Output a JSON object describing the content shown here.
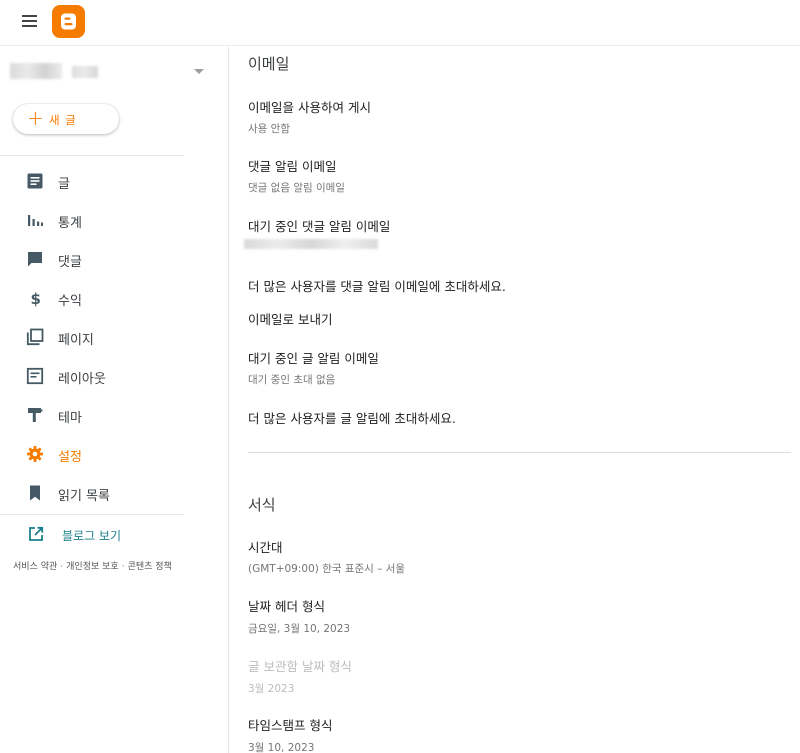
{
  "header": {
    "menu_icon": "hamburger-menu-icon",
    "logo_icon": "blogger-logo-icon",
    "brand_color": "#f57c00"
  },
  "sidebar": {
    "new_post": {
      "plus": "+",
      "label": "새 글"
    },
    "items": [
      {
        "label": "글",
        "icon": "posts-icon"
      },
      {
        "label": "통계",
        "icon": "stats-icon"
      },
      {
        "label": "댓글",
        "icon": "comments-icon"
      },
      {
        "label": "수익",
        "icon": "earnings-icon"
      },
      {
        "label": "페이지",
        "icon": "pages-icon"
      },
      {
        "label": "레이아웃",
        "icon": "layout-icon"
      },
      {
        "label": "테마",
        "icon": "theme-icon"
      },
      {
        "label": "설정",
        "icon": "settings-icon",
        "active": true
      },
      {
        "label": "읽기 목록",
        "icon": "reading-list-icon"
      }
    ],
    "view_blog": {
      "label": "블로그 보기",
      "icon": "open-in-new-icon"
    },
    "footer": {
      "terms": "서비스 약관",
      "privacy": "개인정보 보호",
      "content_policy": "콘텐츠 정책",
      "separator": "·"
    }
  },
  "main": {
    "email_section": {
      "title": "이메일",
      "post_by_email": {
        "title": "이메일을 사용하여 게시",
        "value": "사용 안함"
      },
      "comment_notify": {
        "title": "댓글 알림 이메일",
        "value": "댓글 없음 알림 이메일"
      },
      "pending_comment_notify": {
        "title": "대기 중인 댓글 알림 이메일"
      },
      "invite_comment": "더 많은 사용자를 댓글 알림 이메일에 초대하세요.",
      "email_posts": "이메일로 보내기",
      "pending_post_notify": {
        "title": "대기 중인 글 알림 이메일",
        "value": "대기 중인 초대 없음"
      },
      "invite_post": "더 많은 사용자를 글 알림에 초대하세요."
    },
    "format_section": {
      "title": "서식",
      "timezone": {
        "title": "시간대",
        "value": "(GMT+09:00) 한국 표준시 – 서울"
      },
      "date_header": {
        "title": "날짜 헤더 형식",
        "value": "금요일, 3월 10, 2023"
      },
      "archive_date": {
        "title": "글 보관함 날짜 형식",
        "value": "3월 2023"
      },
      "timestamp": {
        "title": "타임스탬프 형식",
        "value": "3월 10, 2023"
      }
    }
  }
}
